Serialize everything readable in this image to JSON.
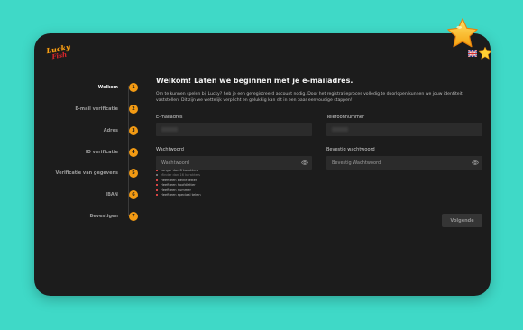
{
  "logo": {
    "line1": "Lucky",
    "line2": "Fish"
  },
  "steps": [
    {
      "number": "1",
      "label": "Welkom",
      "active": true
    },
    {
      "number": "2",
      "label": "E-mail verificatie",
      "active": false
    },
    {
      "number": "3",
      "label": "Adres",
      "active": false
    },
    {
      "number": "4",
      "label": "ID verificatie",
      "active": false
    },
    {
      "number": "5",
      "label": "Verificatie van gegevens",
      "active": false
    },
    {
      "number": "6",
      "label": "IBAN",
      "active": false
    },
    {
      "number": "7",
      "label": "Bevestigen",
      "active": false
    }
  ],
  "main": {
    "title": "Welkom! Laten we beginnen met je e-mailadres.",
    "intro": "Om te kunnen spelen bij Lucky? heb je een geregistreerd account nodig. Door het registratieproces volledig te doorlopen kunnen we jouw identiteit vaststellen. Dit zijn we wettelijk verplicht en gelukkig kan dit in een paar eenvoudige stappen!"
  },
  "form": {
    "email_label": "E-mailadres",
    "phone_label": "Telefoonnummer",
    "password_label": "Wachtwoord",
    "password_placeholder": "Wachtwoord",
    "confirm_label": "Bevestig wachtwoord",
    "confirm_placeholder": "Bevestig Wachtwoord"
  },
  "requirements": [
    {
      "text": "Langer dan 8 karakters",
      "muted": false
    },
    {
      "text": "Minder dan 16 karakters",
      "muted": true
    },
    {
      "text": "Heeft een kleine letter",
      "muted": false
    },
    {
      "text": "Heeft een hoofdletter",
      "muted": false
    },
    {
      "text": "Heeft een nummer",
      "muted": false
    },
    {
      "text": "Heeft een speciaal teken",
      "muted": false
    }
  ],
  "buttons": {
    "next": "Volgende"
  },
  "colors": {
    "background": "#3fd9c7",
    "panel": "#1c1c1c",
    "accent": "#f29a13",
    "error": "#e34848",
    "star": "#ffc21a"
  },
  "icons": [
    "eye-icon",
    "star-icon",
    "uk-flag-icon"
  ]
}
